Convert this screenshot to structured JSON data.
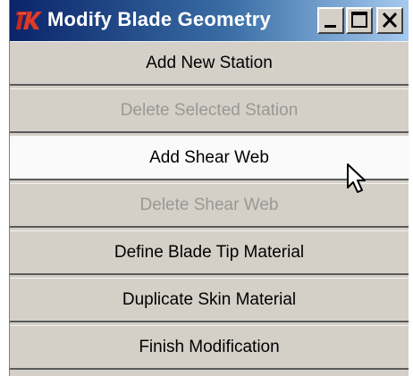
{
  "window": {
    "title": "Modify Blade Geometry"
  },
  "titlebar": {
    "icon": "tk-app-icon",
    "buttons": [
      {
        "name": "minimize",
        "icon": "minimize-icon"
      },
      {
        "name": "maximize",
        "icon": "maximize-icon"
      },
      {
        "name": "close",
        "icon": "close-icon"
      }
    ]
  },
  "menu": {
    "items": [
      {
        "label": "Add New Station",
        "enabled": true
      },
      {
        "label": "Delete Selected Station",
        "enabled": false
      },
      {
        "label": "Add Shear Web",
        "enabled": true,
        "hovered": true
      },
      {
        "label": "Delete Shear Web",
        "enabled": false
      },
      {
        "label": "Define Blade Tip Material",
        "enabled": true
      },
      {
        "label": "Duplicate Skin Material",
        "enabled": true
      },
      {
        "label": "Finish Modification",
        "enabled": true
      }
    ]
  },
  "colors": {
    "titlebar_start": "#0a246a",
    "titlebar_end": "#a6caf0",
    "face": "#d4d0c8",
    "hover_face": "#fafafa",
    "disabled_text": "#9a9894",
    "icon_red": "#c8281e"
  },
  "cursor": {
    "icon": "arrow-pointer-icon"
  }
}
